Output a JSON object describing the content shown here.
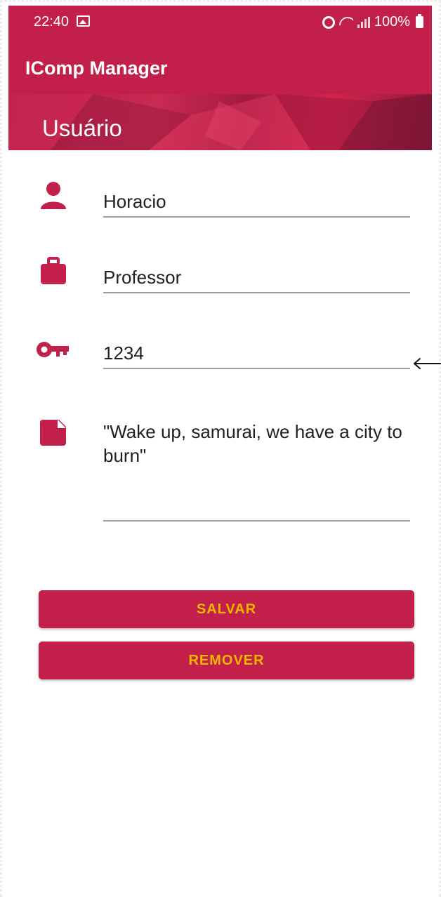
{
  "status_bar": {
    "time": "22:40",
    "battery": "100%",
    "icons": [
      "picture-icon",
      "alarm-icon",
      "wifi-icon",
      "signal-icon",
      "battery-icon"
    ]
  },
  "app_bar": {
    "title": "IComp Manager"
  },
  "banner": {
    "title": "Usuário"
  },
  "form": {
    "name": {
      "value": "Horacio",
      "icon": "person-icon"
    },
    "role": {
      "value": "Professor",
      "icon": "briefcase-icon"
    },
    "password": {
      "value": "1234",
      "icon": "key-icon"
    },
    "note": {
      "value": "\"Wake up, samurai, we have a city to burn\"",
      "icon": "note-icon"
    }
  },
  "buttons": {
    "save_label": "SALVAR",
    "remove_label": "REMOVER"
  },
  "colors": {
    "primary": "#c2204b",
    "accent": "#f5b800",
    "icon": "#c2204b"
  }
}
